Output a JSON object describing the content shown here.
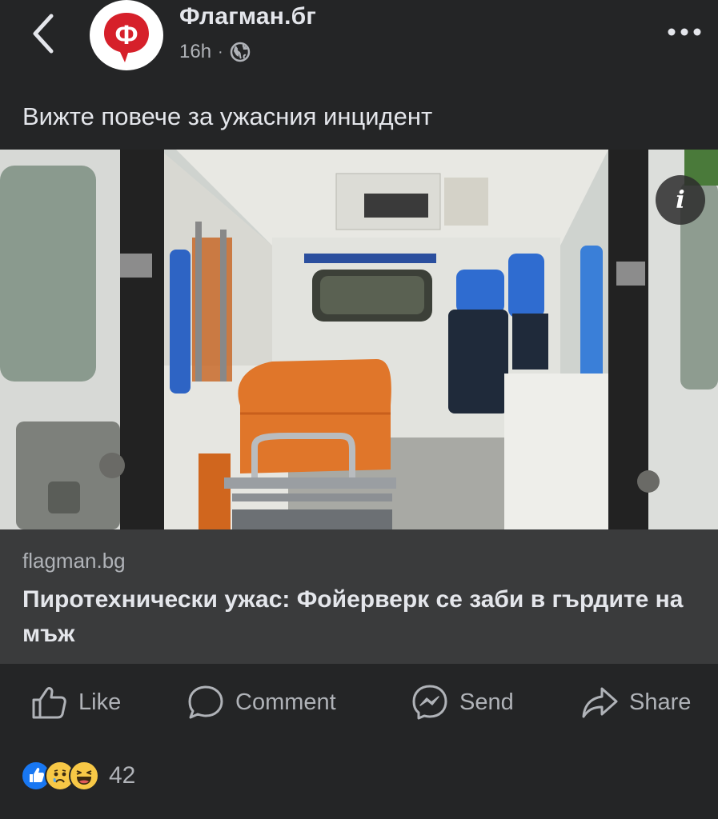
{
  "header": {
    "page_name": "Флагман.бг",
    "avatar_letter": "Ф",
    "time": "16h",
    "dot": "·",
    "privacy_icon": "globe-icon"
  },
  "post": {
    "text": "Вижте повече за ужасния инцидент"
  },
  "image": {
    "info_label": "i"
  },
  "link_preview": {
    "domain": "flagman.bg",
    "title": "Пиротехнически ужас: Фойерверк се заби в гърдите на мъж"
  },
  "actions": {
    "like": "Like",
    "comment": "Comment",
    "send": "Send",
    "share": "Share"
  },
  "reactions": {
    "icons": [
      "like-reaction-icon",
      "sad-reaction-icon",
      "haha-reaction-icon"
    ],
    "count": "42"
  },
  "colors": {
    "background": "#242526",
    "link_box": "#3a3b3c",
    "brand_red": "#d6202a",
    "like_blue": "#1877f2"
  }
}
